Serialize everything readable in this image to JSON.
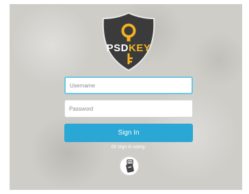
{
  "brand": {
    "logo_prefix": "PSD",
    "logo_suffix": "KEY"
  },
  "login": {
    "username_placeholder": "Username",
    "password_placeholder": "Password",
    "signin_label": "Sign In",
    "alt_signin_text": "Or sign in using:"
  },
  "icons": {
    "logo": "key-shield-icon",
    "alt_login": "usb-key-icon"
  },
  "colors": {
    "primary_button": "#2aa7d4",
    "focus_border": "#6cc5e3",
    "logo_accent": "#f4b223",
    "shield": "#3b3b3b"
  }
}
